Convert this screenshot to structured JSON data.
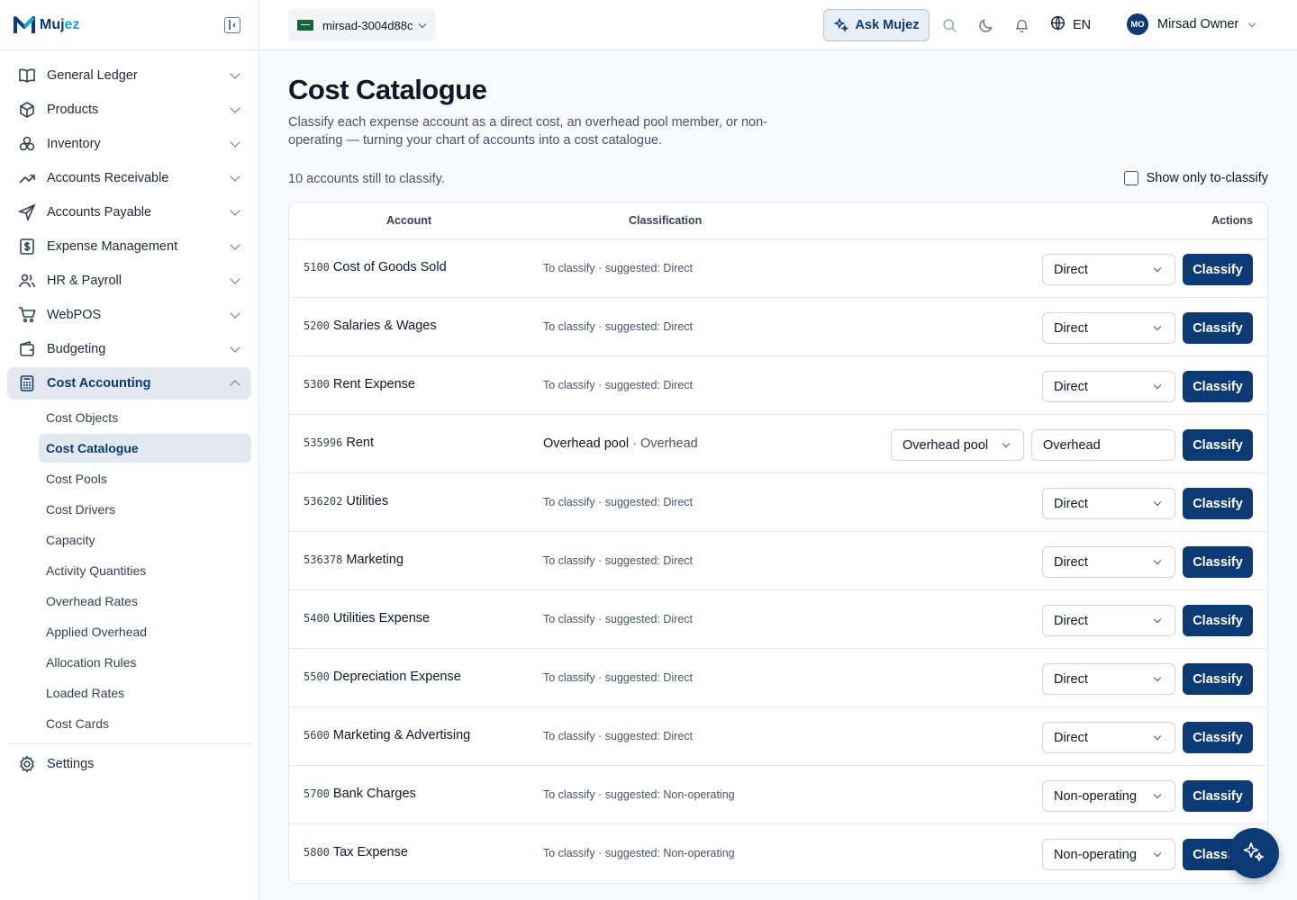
{
  "app": {
    "name_main": "Muj",
    "name_accent": "ez"
  },
  "sidebar": {
    "items": [
      {
        "label": "General Ledger",
        "icon": "book-icon"
      },
      {
        "label": "Products",
        "icon": "box-icon"
      },
      {
        "label": "Inventory",
        "icon": "boxes-icon"
      },
      {
        "label": "Accounts Receivable",
        "icon": "trending-up-icon"
      },
      {
        "label": "Accounts Payable",
        "icon": "send-icon"
      },
      {
        "label": "Expense Management",
        "icon": "receipt-icon"
      },
      {
        "label": "HR & Payroll",
        "icon": "users-icon"
      },
      {
        "label": "WebPOS",
        "icon": "cart-icon"
      },
      {
        "label": "Budgeting",
        "icon": "wallet-icon"
      },
      {
        "label": "Cost Accounting",
        "icon": "calculator-icon"
      }
    ],
    "cost_sub": [
      "Cost Objects",
      "Cost Catalogue",
      "Cost Pools",
      "Cost Drivers",
      "Capacity",
      "Activity Quantities",
      "Overhead Rates",
      "Applied Overhead",
      "Allocation Rules",
      "Loaded Rates",
      "Cost Cards"
    ],
    "settings_label": "Settings"
  },
  "topbar": {
    "org": "mirsad-3004d88c",
    "ask_label": "Ask Mujez",
    "lang": "EN",
    "user_initials": "MO",
    "user_name": "Mirsad Owner"
  },
  "page": {
    "title": "Cost Catalogue",
    "description": "Classify each expense account as a direct cost, an overhead pool member, or non-operating — turning your chart of accounts into a cost catalogue.",
    "status": "10 accounts still to classify.",
    "filter_label": "Show only to-classify"
  },
  "table": {
    "headers": {
      "account": "Account",
      "classification": "Classification",
      "actions": "Actions"
    },
    "button_label": "Classify",
    "rows": [
      {
        "code": "5100",
        "name": "Cost of Goods Sold",
        "status": "To classify · suggested: Direct",
        "select": "Direct"
      },
      {
        "code": "5200",
        "name": "Salaries & Wages",
        "status": "To classify · suggested: Direct",
        "select": "Direct"
      },
      {
        "code": "5300",
        "name": "Rent Expense",
        "status": "To classify · suggested: Direct",
        "select": "Direct"
      },
      {
        "code": "535996",
        "name": "Rent",
        "status_main": "Overhead pool",
        "status_sep": " · ",
        "status_sub": "Overhead",
        "select": "Overhead pool",
        "input_value": "Overhead"
      },
      {
        "code": "536202",
        "name": "Utilities",
        "status": "To classify · suggested: Direct",
        "select": "Direct"
      },
      {
        "code": "536378",
        "name": "Marketing",
        "status": "To classify · suggested: Direct",
        "select": "Direct"
      },
      {
        "code": "5400",
        "name": "Utilities Expense",
        "status": "To classify · suggested: Direct",
        "select": "Direct"
      },
      {
        "code": "5500",
        "name": "Depreciation Expense",
        "status": "To classify · suggested: Direct",
        "select": "Direct"
      },
      {
        "code": "5600",
        "name": "Marketing & Advertising",
        "status": "To classify · suggested: Direct",
        "select": "Direct"
      },
      {
        "code": "5700",
        "name": "Bank Charges",
        "status": "To classify · suggested: Non-operating",
        "select": "Non-operating"
      },
      {
        "code": "5800",
        "name": "Tax Expense",
        "status": "To classify · suggested: Non-operating",
        "select": "Non-operating"
      }
    ]
  },
  "colors": {
    "brand": "#0b3a75",
    "accent": "#0ea5e9",
    "active_bg": "#e2e8f0"
  }
}
